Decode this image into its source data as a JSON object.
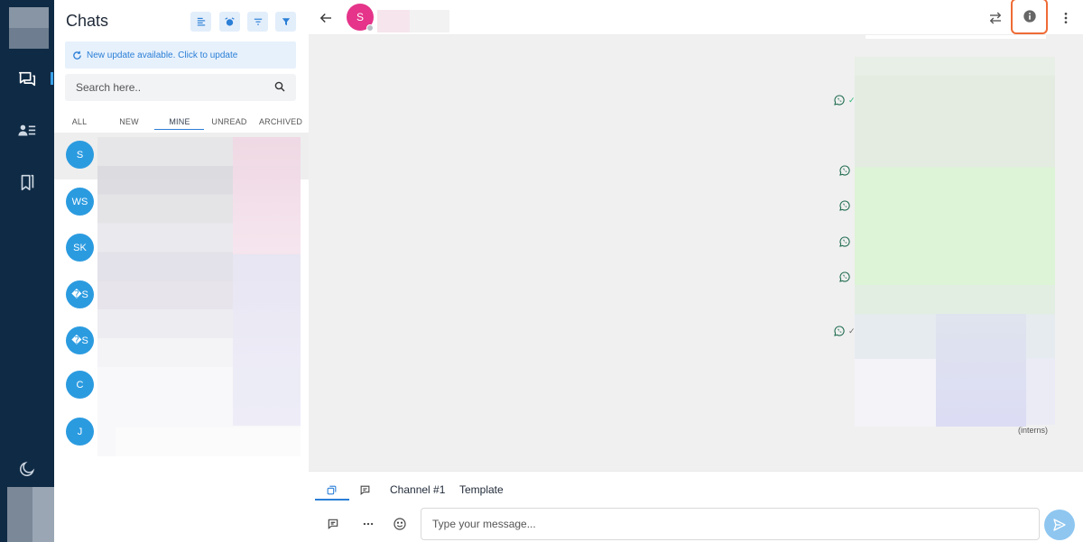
{
  "sidebar": {
    "icons": [
      "chat-bubbles-icon",
      "contacts-icon",
      "bookmarks-icon",
      "moon-icon"
    ]
  },
  "chats": {
    "title": "Chats",
    "toolbar_icons": [
      "list-icon",
      "alarm-icon",
      "sort-icon",
      "filter-icon"
    ],
    "update_banner": "New update available. Click to update",
    "search_placeholder": "Search here..",
    "filter_tabs": [
      "ALL",
      "NEW",
      "MINE",
      "UNREAD",
      "ARCHIVED"
    ],
    "active_filter": "MINE",
    "items": [
      {
        "initials": "S"
      },
      {
        "initials": "WS"
      },
      {
        "initials": "SK"
      },
      {
        "initials": "�S"
      },
      {
        "initials": "�S"
      },
      {
        "initials": "C"
      },
      {
        "initials": "J"
      }
    ]
  },
  "conversation": {
    "contact_initial": "S",
    "header_icons": [
      "back-arrow-icon",
      "transfer-icon",
      "info-icon",
      "more-vertical-icon"
    ],
    "caption": "(interns)"
  },
  "composer": {
    "tabs": [
      "Channel #1",
      "Template"
    ],
    "input_placeholder": "Type your message..."
  },
  "colors": {
    "rail": "#0f2a44",
    "accent": "#2b7fd6",
    "avatar": "#2b9be0",
    "contact_avatar": "#e5348a",
    "info_highlight": "#ef6b35",
    "send": "#8ec6f0"
  }
}
